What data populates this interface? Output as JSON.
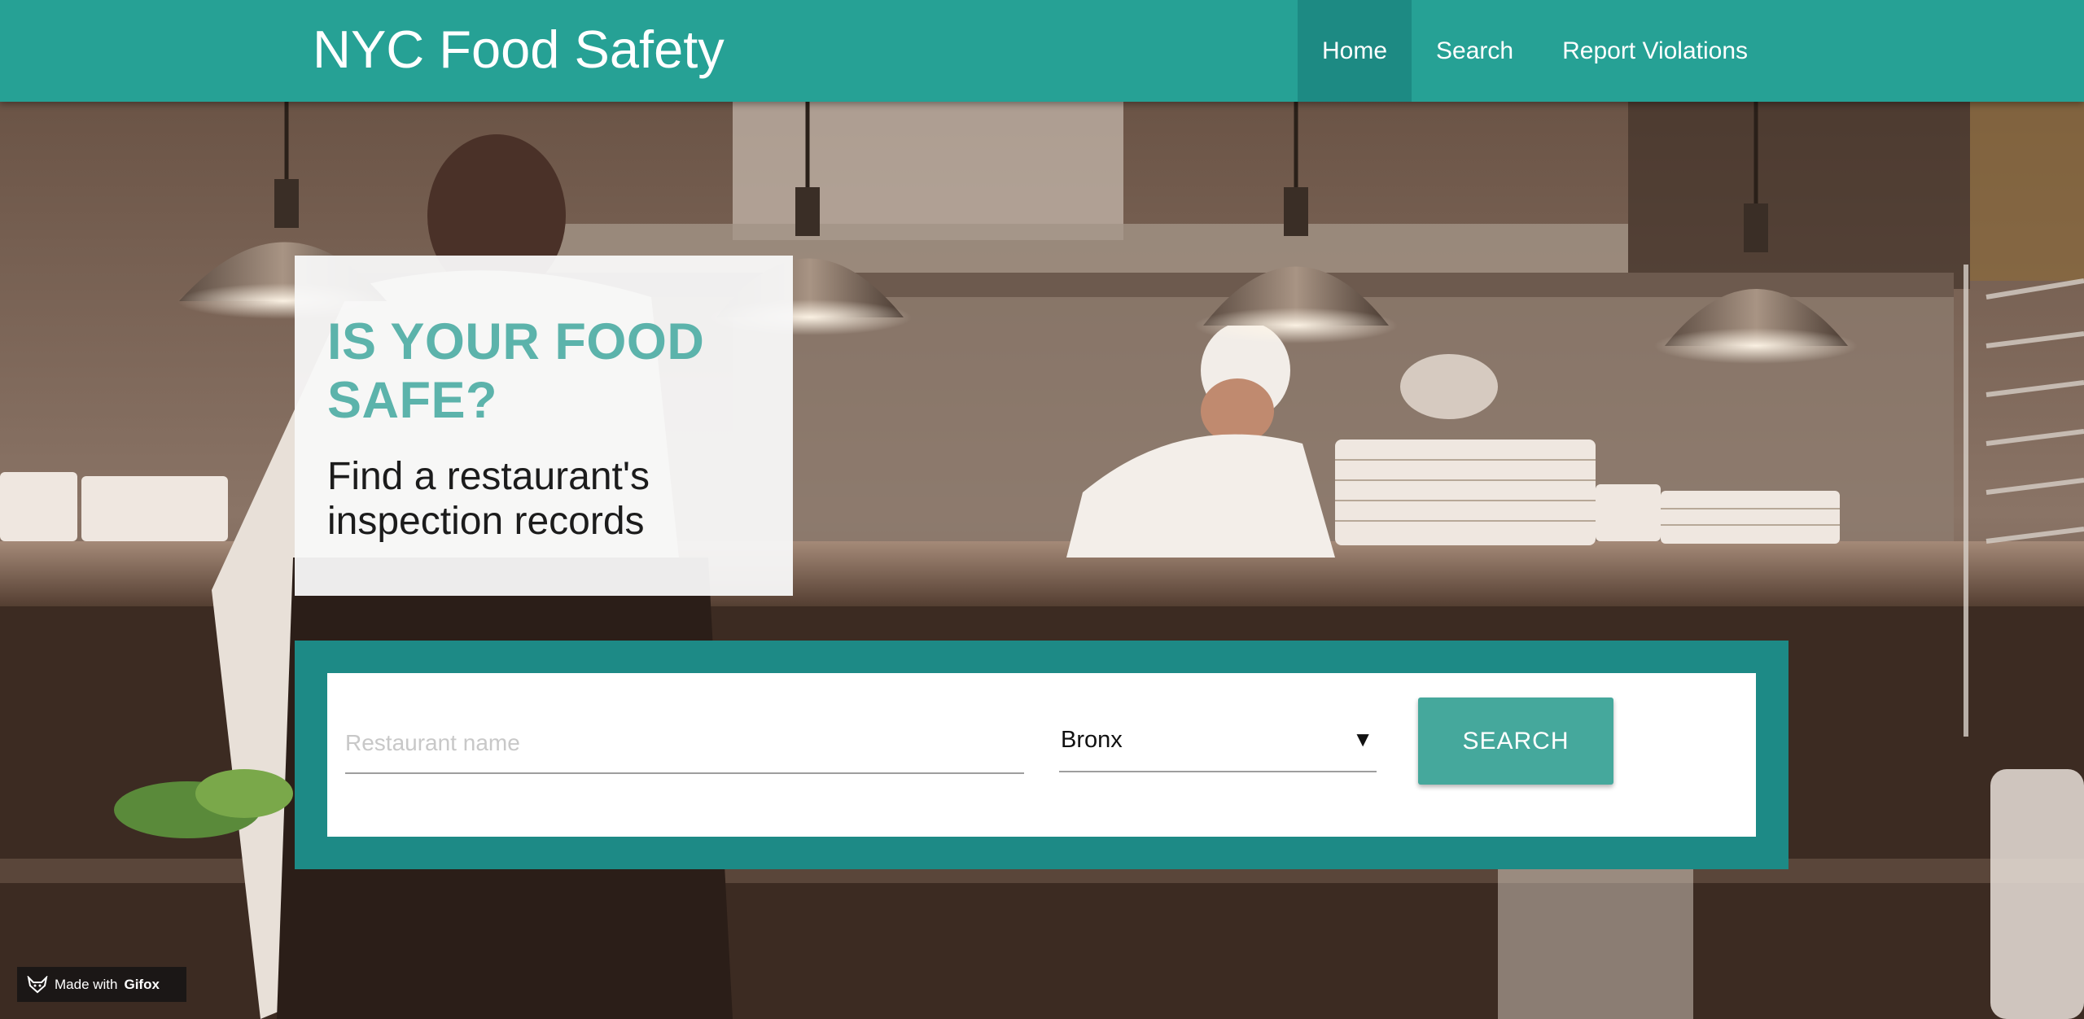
{
  "header": {
    "brand": "NYC Food Safety",
    "nav": [
      {
        "label": "Home",
        "active": true
      },
      {
        "label": "Search",
        "active": false
      },
      {
        "label": "Report Violations",
        "active": false
      }
    ]
  },
  "hero": {
    "title": "IS YOUR FOOD SAFE?",
    "subtitle": "Find a restaurant's inspection records"
  },
  "search": {
    "name_placeholder": "Restaurant name",
    "name_value": "",
    "borough_selected": "Bronx",
    "button_label": "SEARCH"
  },
  "watermark": {
    "prefix": "Made with",
    "brand": "Gifox"
  },
  "colors": {
    "primary": "#26a195",
    "nav_active": "#1d8a83",
    "accent_title": "#5cb3ab",
    "search_frame": "#1d8a86",
    "button": "#45a89c"
  }
}
